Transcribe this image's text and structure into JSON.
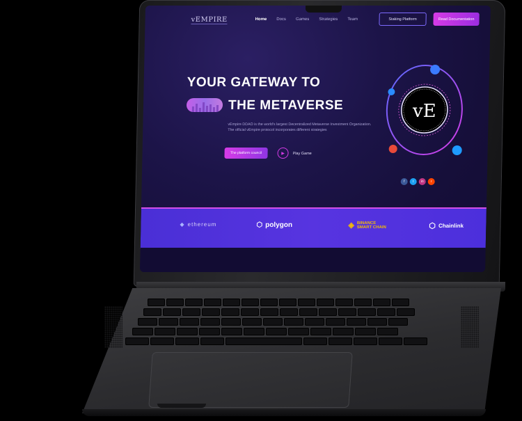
{
  "nav": {
    "logo": "vEMPIRE",
    "links": [
      "Home",
      "Docs",
      "Games",
      "Strategies",
      "Team"
    ],
    "active_index": 0,
    "staking_button": "Staking Platform",
    "docs_button": "Read Documentation"
  },
  "hero": {
    "title_line1": "YOUR GATEWAY TO",
    "title_line2": "THE METAVERSE",
    "description": "vEmpire DDAO is the world's largest Decentralized Metaverse Investment Organization. The official vEmpire protocol incorporates different strategies",
    "cta_button": "The platform council",
    "play_label": "Play Game",
    "emblem_text": "vE"
  },
  "socials": [
    "f",
    "t",
    "in",
    "r"
  ],
  "partners": {
    "ethereum": "ethereum",
    "polygon": "polygon",
    "binance_line1": "BINANCE",
    "binance_line2": "SMART CHAIN",
    "chainlink": "Chainlink"
  },
  "colors": {
    "accent_pink": "#d63be6",
    "accent_purple": "#7e6bff",
    "band_blue": "#5734e0",
    "background": "#1c1448"
  }
}
